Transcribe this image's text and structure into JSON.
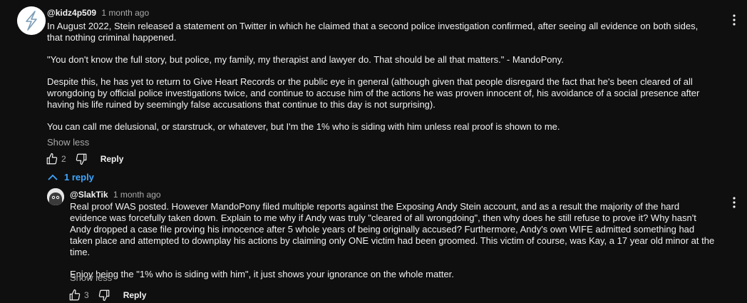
{
  "comment": {
    "author": "@kidz4p509",
    "time": "1 month ago",
    "paragraphs": [
      "In August 2022, Stein released a statement on Twitter in which he claimed that a second police investigation confirmed, after seeing all evidence on both sides, that nothing criminal happened.",
      "\"You don't know the full story, but police, my family, my therapist and lawyer do. That should be all that matters.\" - MandoPony.",
      "Despite this, he has yet to return to Give Heart Records or the public eye in general (although given that people disregard the fact that he's been cleared of all wrongdoing by official police investigations twice, and continue to accuse him of the actions he was proven innocent of, his avoidance of a social presence after having his life ruined by seemingly false accusations that continue to this day is not surprising).",
      "You can call me delusional, or starstruck, or whatever, but I'm the 1% who is siding with him unless real proof is shown to me."
    ],
    "show_less": "Show less",
    "likes": "2",
    "reply_label": "Reply",
    "replies_toggle": "1 reply"
  },
  "reply": {
    "author": "@SlakTik",
    "time": "1 month ago",
    "paragraphs": [
      "Real proof WAS posted. However MandoPony filed multiple reports against the Exposing Andy Stein account, and as a result the majority of the hard evidence was forcefully taken down. Explain to me why if Andy was truly \"cleared of all wrongdoing\", then why does he still refuse to prove it? Why hasn't Andy dropped a case file proving his innocence after 5 whole years of being originally accused? Furthermore, Andy's own WIFE admitted something had taken place and attempted to downplay his actions by claiming only ONE victim had been groomed. This victim of course, was Kay, a 17 year old minor at the time.",
      "Enjoy being the \"1% who is siding with him\", it just shows your ignorance on the whole matter."
    ],
    "show_less": "Show less",
    "likes": "3",
    "reply_label": "Reply"
  },
  "colors": {
    "background": "#0f0f0f",
    "text": "#f1f1f1",
    "secondary": "#aaaaaa",
    "link": "#3ea6ff"
  }
}
